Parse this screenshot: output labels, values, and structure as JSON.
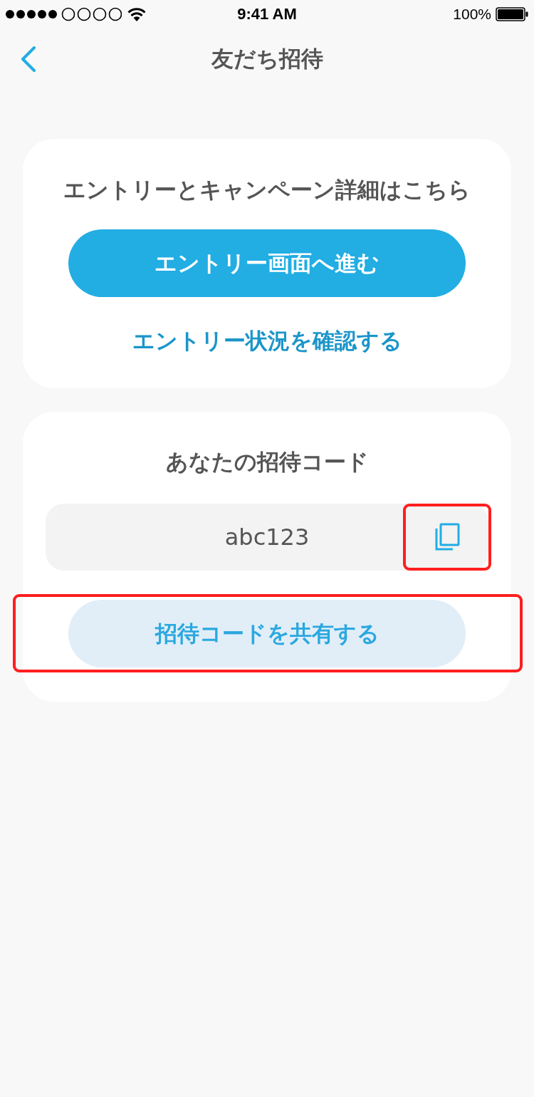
{
  "status_bar": {
    "time": "9:41 AM",
    "battery": "100%"
  },
  "nav_bar": {
    "title": "友だち招待"
  },
  "entry_card": {
    "heading": "エントリーとキャンペーン詳細はこちら",
    "entry_button": "エントリー画面へ進む",
    "status_link": "エントリー状況を確認する"
  },
  "invite_card": {
    "label": "あなたの招待コード",
    "code": "abc123",
    "copy_button": {
      "highlighted": true
    },
    "share_button": {
      "label": "招待コードを共有する",
      "highlighted": true
    }
  }
}
